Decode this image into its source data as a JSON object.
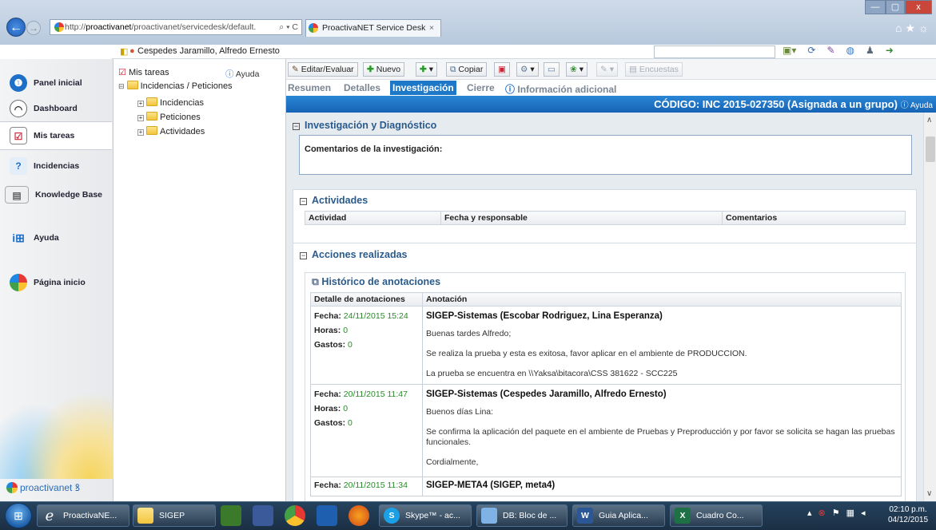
{
  "browser": {
    "url_prefix": "http://",
    "url_domain": "proactivanet",
    "url_rest": "/proactivanet/servicedesk/default.",
    "url_controls": "⌕ ▾ C",
    "tab_title": "ProactivaNET Service Desk",
    "tab_close": "×",
    "win_min": "—",
    "win_max": "▢",
    "win_close": "x",
    "ie_icons": "⌂★☼"
  },
  "header": {
    "user_name": "Cespedes Jaramillo, Alfredo Ernesto"
  },
  "sidebar": {
    "items": [
      {
        "label": "Panel inicial"
      },
      {
        "label": "Dashboard"
      },
      {
        "label": "Mis tareas"
      },
      {
        "label": "Incidencias"
      },
      {
        "label": "Knowledge Base"
      },
      {
        "label": "Ayuda"
      },
      {
        "label": "Página inicio"
      }
    ],
    "logo_text": "proactivanet"
  },
  "tree": {
    "root": "Mis tareas",
    "help": "Ayuda",
    "folder": "Incidencias / Peticiones",
    "children": [
      "Incidencias",
      "Peticiones",
      "Actividades"
    ]
  },
  "toolbar": {
    "edit": "Editar/Evaluar",
    "new": "Nuevo",
    "copy": "Copiar",
    "surveys": "Encuestas"
  },
  "tabs": [
    "Resumen",
    "Detalles",
    "Investigación",
    "Cierre",
    "Información adicional"
  ],
  "code_bar": {
    "text": "CÓDIGO: INC 2015-027350 (Asignada a un grupo)",
    "help": "Ayuda"
  },
  "investigation": {
    "title": "Investigación y Diagnóstico",
    "comments_label": "Comentarios de la investigación:"
  },
  "activities": {
    "title": "Actividades",
    "columns": [
      "Actividad",
      "Fecha y responsable",
      "Comentarios"
    ]
  },
  "actions": {
    "title": "Acciones realizadas",
    "history_title": "Histórico de anotaciones",
    "columns": [
      "Detalle de anotaciones",
      "Anotación"
    ],
    "labels": {
      "date": "Fecha:",
      "hours": "Horas:",
      "expenses": "Gastos:"
    },
    "rows": [
      {
        "date": "24/11/2015 15:24",
        "hours": "0",
        "expenses": "0",
        "author": "SIGEP-Sistemas (Escobar Rodriguez, Lina Esperanza)",
        "lines": [
          "Buenas tardes Alfredo;",
          "Se realiza la prueba y esta es exitosa, favor aplicar en el ambiente de PRODUCCION.",
          "La prueba se encuentra en \\\\Yaksa\\bitacora\\CSS 381622 - SCC225"
        ]
      },
      {
        "date": "20/11/2015 11:47",
        "hours": "0",
        "expenses": "0",
        "author": "SIGEP-Sistemas (Cespedes Jaramillo, Alfredo Ernesto)",
        "lines": [
          "Buenos días Lina:",
          "Se confirma la aplicación del paquete en el ambiente de Pruebas y Preproducción y por favor se solicita se hagan las pruebas funcionales.",
          "Cordialmente,"
        ]
      },
      {
        "date": "20/11/2015 11:34",
        "author": "SIGEP-META4 (SIGEP, meta4)"
      }
    ]
  },
  "taskbar": {
    "items": [
      "ProactivaNE...",
      "SIGEP",
      "Skype™ - ac...",
      "DB: Bloc de ...",
      "Guia Aplica...",
      "Cuadro Co..."
    ],
    "time": "02:10 p.m.",
    "date": "04/12/2015"
  }
}
